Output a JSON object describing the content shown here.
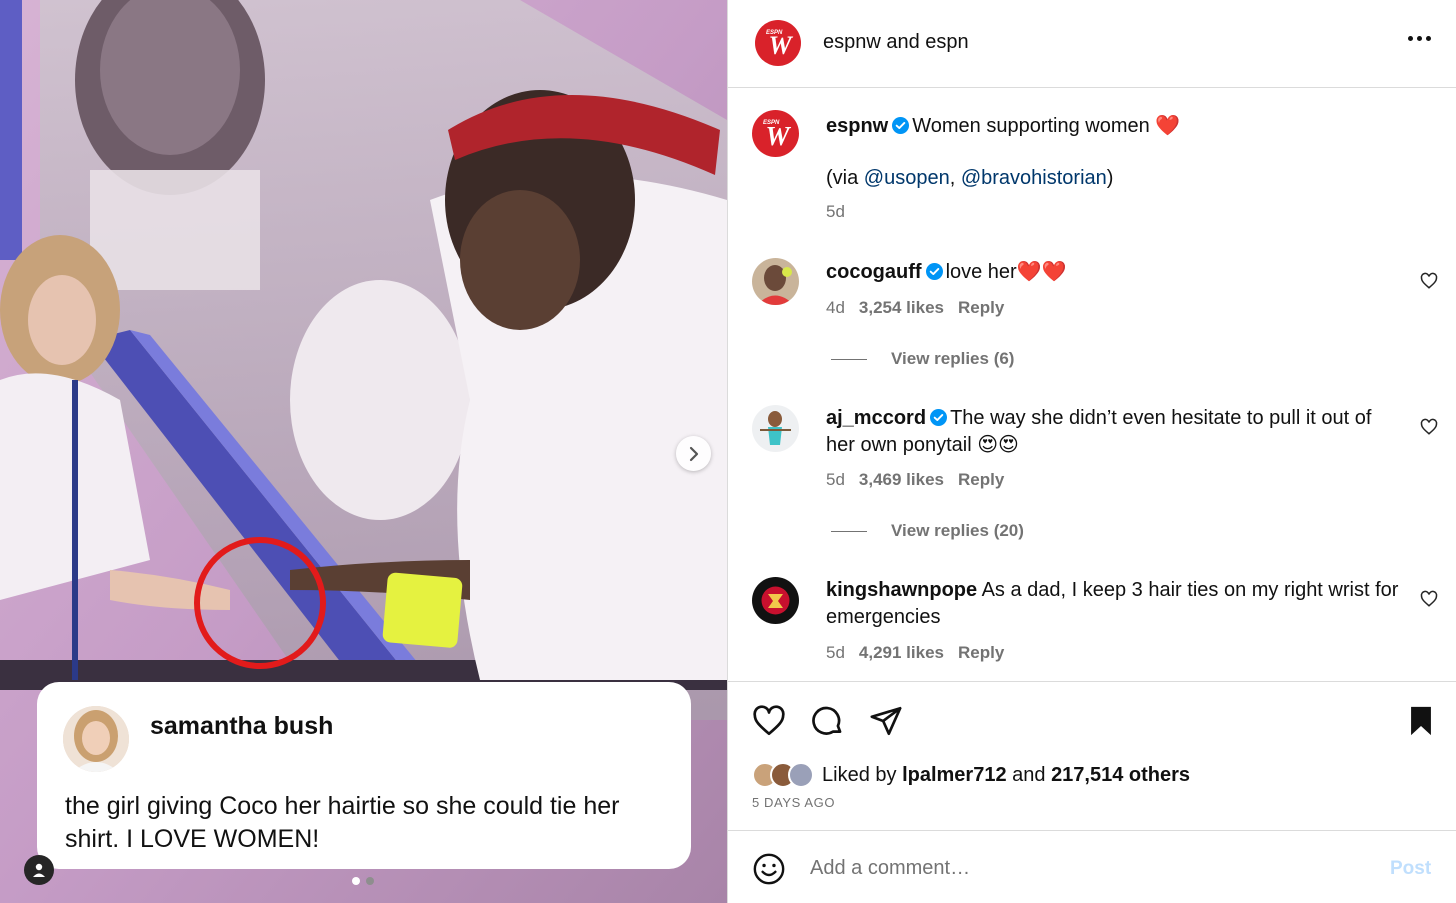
{
  "media": {
    "overlay_card": {
      "name": "samantha bush",
      "text": "the girl giving Coco her hairtie so she could tie her shirt. I LOVE WOMEN!"
    },
    "next_icon": "chevron-right-icon",
    "user_tag_icon": "person-icon",
    "carousel": {
      "count": 2,
      "active_index": 0
    }
  },
  "header": {
    "title": "espnw and espn",
    "logo_text": "W",
    "logo_badge": "ESPN",
    "more_icon": "more-horizontal-icon"
  },
  "caption": {
    "username": "espnw",
    "text": "Women supporting women ❤️",
    "via_prefix": "(via ",
    "mention_1": "@usopen",
    "separator": ", ",
    "mention_2": "@bravohistorian",
    "via_suffix": ")",
    "time": "5d"
  },
  "comments": [
    {
      "username": "cocogauff",
      "verified": true,
      "text": "love her❤️❤️",
      "time": "4d",
      "likes": "3,254 likes",
      "reply": "Reply",
      "view_replies": "View replies (6)"
    },
    {
      "username": "aj_mccord",
      "verified": true,
      "text": "The way she didn’t even hesitate to pull it out of her own ponytail 😍😍",
      "time": "5d",
      "likes": "3,469 likes",
      "reply": "Reply",
      "view_replies": "View replies (20)"
    },
    {
      "username": "kingshawnpope",
      "verified": false,
      "text": "As a dad, I keep 3 hair ties on my right wrist for emergencies",
      "time": "5d",
      "likes": "4,291 likes",
      "reply": "Reply"
    }
  ],
  "actions": {
    "like_icon": "heart-icon",
    "comment_icon": "comment-icon",
    "share_icon": "send-icon",
    "save_icon": "bookmark-icon",
    "liked_by_prefix": "Liked by ",
    "liked_by_user": "lpalmer712",
    "liked_by_and": " and ",
    "liked_by_others": "217,514 others",
    "posted_ago": "5 DAYS AGO"
  },
  "comment_box": {
    "emoji_icon": "smiley-icon",
    "placeholder": "Add a comment…",
    "post_label": "Post"
  },
  "colors": {
    "espn_red": "#d9222a",
    "link_blue": "#00376b",
    "verified_blue": "#0095f6",
    "post_disabled": "#c0dffd",
    "secondary_text": "#737373"
  }
}
